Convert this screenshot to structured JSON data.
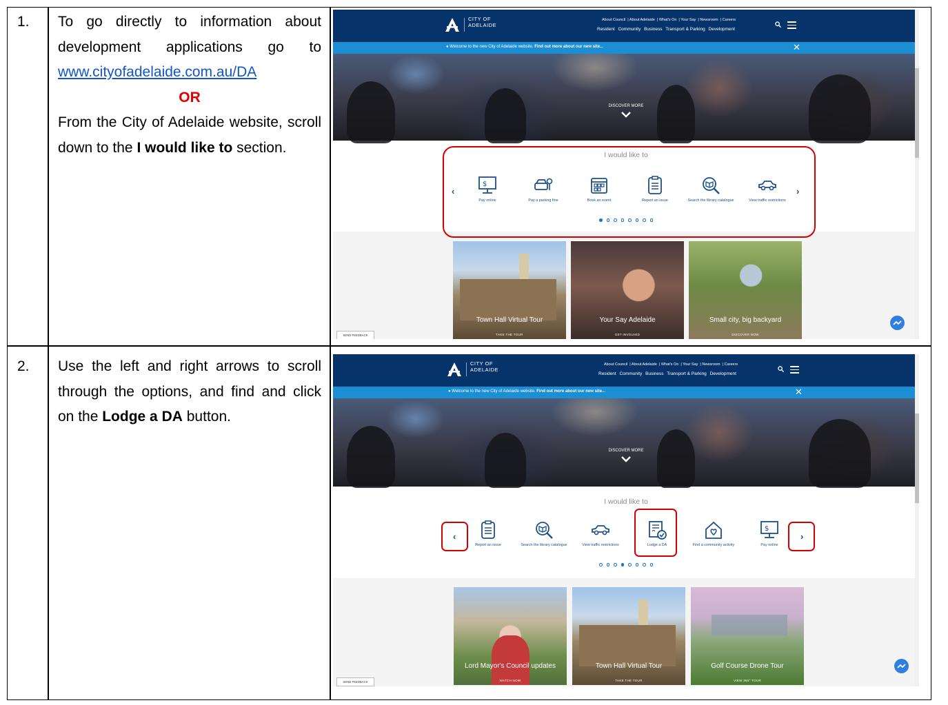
{
  "rows": [
    {
      "number": "1.",
      "link": "www.cityofadelaide.com.au/DA",
      "intro": "To go directly to information about development applications go to",
      "or": "OR",
      "body_pre": "From the City of Adelaide website, scroll down to the",
      "body_bold": "I would like to",
      "body_post": "section."
    },
    {
      "number": "2.",
      "body_pre": "Use the left and right arrows to scroll through the options, and find and click on the",
      "body_bold": "Lodge a DA",
      "body_post": "button."
    }
  ],
  "site": {
    "logo_line1": "CITY OF",
    "logo_line2": "ADELAIDE",
    "top_links": [
      "About Council",
      "About Adelaide",
      "What's On",
      "Your Say",
      "Newsroom",
      "Careers"
    ],
    "main_links": [
      "Resident",
      "Community",
      "Business",
      "Transport & Parking",
      "Development"
    ],
    "banner_text": "Welcome to the new City of Adelaide website.",
    "banner_link": "Find out more about our new site...",
    "banner_close": "✕",
    "discover": "DISCOVER MORE",
    "would_like": "I would like to",
    "prev_arrow": "‹",
    "next_arrow": "›",
    "feedback": "SEND FEEDBACK"
  },
  "shot1": {
    "cards": [
      {
        "label": "Pay online",
        "icon": "pay-online-icon"
      },
      {
        "label": "Pay a parking fine",
        "icon": "parking-fine-icon"
      },
      {
        "label": "Book an event",
        "icon": "calendar-icon"
      },
      {
        "label": "Report an issue",
        "icon": "clipboard-icon"
      },
      {
        "label": "Search the library catalogue",
        "icon": "library-search-icon"
      },
      {
        "label": "View traffic restrictions",
        "icon": "car-icon"
      }
    ],
    "active_dot": 0,
    "tiles": [
      {
        "title": "Town Hall Virtual Tour",
        "sub": "TAKE THE TOUR"
      },
      {
        "title": "Your Say Adelaide",
        "sub": "GET INVOLVED"
      },
      {
        "title": "Small city, big backyard",
        "sub": "DISCOVER NOW"
      }
    ]
  },
  "shot2": {
    "cards": [
      {
        "label": "Report an issue",
        "icon": "clipboard-icon"
      },
      {
        "label": "Search the library catalogue",
        "icon": "library-search-icon"
      },
      {
        "label": "View traffic restrictions",
        "icon": "car-icon"
      },
      {
        "label": "Lodge a DA",
        "icon": "lodge-da-icon"
      },
      {
        "label": "Find a community activity",
        "icon": "community-house-icon"
      },
      {
        "label": "Pay online",
        "icon": "pay-online-icon"
      }
    ],
    "active_dot": 3,
    "tiles": [
      {
        "title": "Lord Mayor's Council updates",
        "sub": "WATCH NOW"
      },
      {
        "title": "Town Hall Virtual Tour",
        "sub": "TAKE THE TOUR"
      },
      {
        "title": "Golf Course Drone Tour",
        "sub": "VIEW 360° TOUR"
      }
    ]
  },
  "colors": {
    "header": "#07336b",
    "banner": "#1c8ed3",
    "highlight": "#d40000",
    "or_text": "#e00000",
    "link": "#1155cc"
  }
}
